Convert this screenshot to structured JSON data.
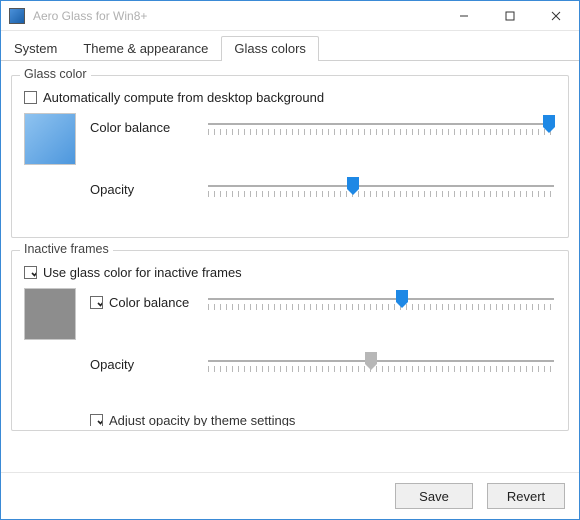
{
  "window": {
    "title": "Aero Glass for Win8+"
  },
  "win_controls": {
    "min": "minimize",
    "max": "maximize",
    "close": "close"
  },
  "tabs": [
    {
      "label": "System",
      "active": false
    },
    {
      "label": "Theme & appearance",
      "active": false
    },
    {
      "label": "Glass colors",
      "active": true
    }
  ],
  "glass_color": {
    "legend": "Glass color",
    "auto_compute": {
      "label": "Automatically compute from desktop background",
      "checked": false
    },
    "color_balance": {
      "label": "Color balance",
      "value_pct": 98
    },
    "opacity": {
      "label": "Opacity",
      "value_pct": 42
    },
    "swatch_color": "#5ca6e3"
  },
  "inactive_frames": {
    "legend": "Inactive frames",
    "use_glass": {
      "label": "Use glass color for inactive frames",
      "checked": true
    },
    "color_balance": {
      "label": "Color balance",
      "checked": true,
      "value_pct": 56
    },
    "opacity": {
      "label": "Opacity",
      "value_pct": 47,
      "disabled": true
    },
    "adjust_opacity": {
      "label": "Adjust opacity by theme settings",
      "checked": true
    },
    "swatch_color": "#8d8d8d"
  },
  "footer": {
    "save": "Save",
    "revert": "Revert"
  },
  "colors": {
    "accent": "#1e88e5",
    "thumb_disabled": "#b7b7b7"
  }
}
